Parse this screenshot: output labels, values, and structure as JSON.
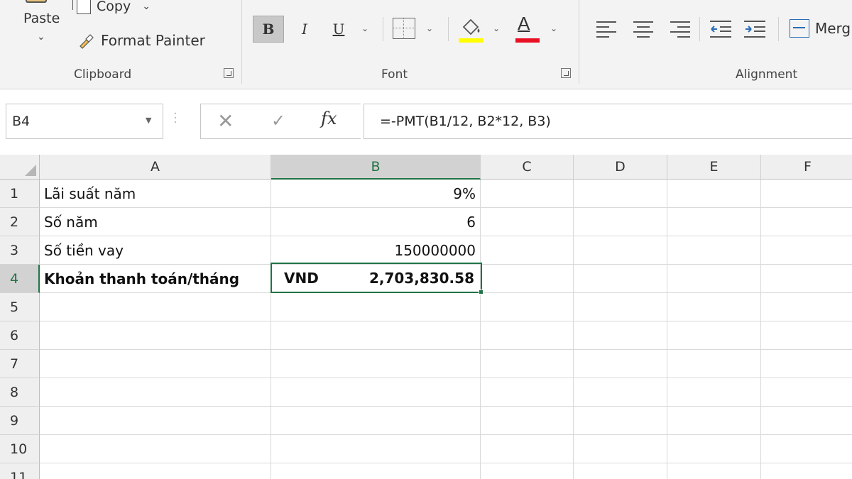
{
  "ribbon": {
    "clipboard": {
      "paste_label": "Paste",
      "copy_label": "Copy",
      "format_painter_label": "Format Painter",
      "group_label": "Clipboard"
    },
    "font": {
      "bold_label": "B",
      "italic_label": "I",
      "underline_label": "U",
      "font_color_label": "A",
      "fill_color": "#ffff00",
      "font_color": "#e81123",
      "group_label": "Font"
    },
    "alignment": {
      "merge_label": "Merg",
      "group_label": "Alignment"
    },
    "icons": [
      "paste-icon",
      "copy-icon",
      "format-painter-icon",
      "bold-icon",
      "italic-icon",
      "underline-icon",
      "borders-icon",
      "fill-color-icon",
      "font-color-icon",
      "align-left-icon",
      "align-center-icon",
      "align-right-icon",
      "decrease-indent-icon",
      "increase-indent-icon",
      "merge-center-icon"
    ]
  },
  "formula_bar": {
    "name_box": "B4",
    "fx_label": "fx",
    "formula": "=-PMT(B1/12, B2*12, B3)"
  },
  "sheet": {
    "columns": [
      "A",
      "B",
      "C",
      "D",
      "E",
      "F"
    ],
    "rows": [
      "1",
      "2",
      "3",
      "4",
      "5",
      "6",
      "7",
      "8",
      "9",
      "10",
      "11"
    ],
    "cells": {
      "A1": "Lãi suất năm",
      "B1": "9%",
      "A2": "Số năm",
      "B2": "6",
      "A3": "Số tiền vay",
      "B3": "150000000",
      "A4": "Khoản thanh toán/tháng",
      "B4_currency": "VND",
      "B4_amount": "2,703,830.58"
    },
    "selected_cell": "B4",
    "accent_color": "#217346"
  }
}
